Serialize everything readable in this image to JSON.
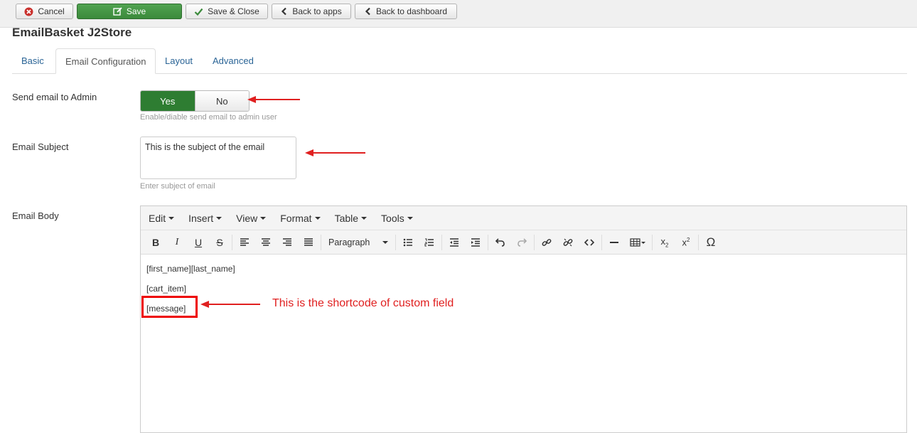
{
  "toolbar": {
    "cancel_label": "Cancel",
    "save_label": "Save",
    "save_close_label": "Save & Close",
    "back_apps_label": "Back to apps",
    "back_dashboard_label": "Back to dashboard"
  },
  "page": {
    "title": "EmailBasket J2Store"
  },
  "tabs": [
    {
      "label": "Basic"
    },
    {
      "label": "Email Configuration",
      "active": true
    },
    {
      "label": "Layout"
    },
    {
      "label": "Advanced"
    }
  ],
  "form": {
    "send_email": {
      "label": "Send email to Admin",
      "yes": "Yes",
      "no": "No",
      "selected": "Yes",
      "help": "Enable/diable send email to admin user"
    },
    "subject": {
      "label": "Email Subject",
      "value": "This is the subject of the email",
      "help": "Enter subject of email"
    },
    "body": {
      "label": "Email Body",
      "menus": [
        "Edit",
        "Insert",
        "View",
        "Format",
        "Table",
        "Tools"
      ],
      "format_select": "Paragraph",
      "lines": [
        "[first_name][last_name]",
        "[cart_item]",
        "[message]"
      ]
    }
  },
  "annotation": {
    "text": "This is the shortcode of custom field",
    "color": "#e02020"
  },
  "colors": {
    "save_green": "#3b8a3b",
    "yes_green": "#2e7d32",
    "link_blue": "#2a6496",
    "annotation_red": "#e02020"
  }
}
